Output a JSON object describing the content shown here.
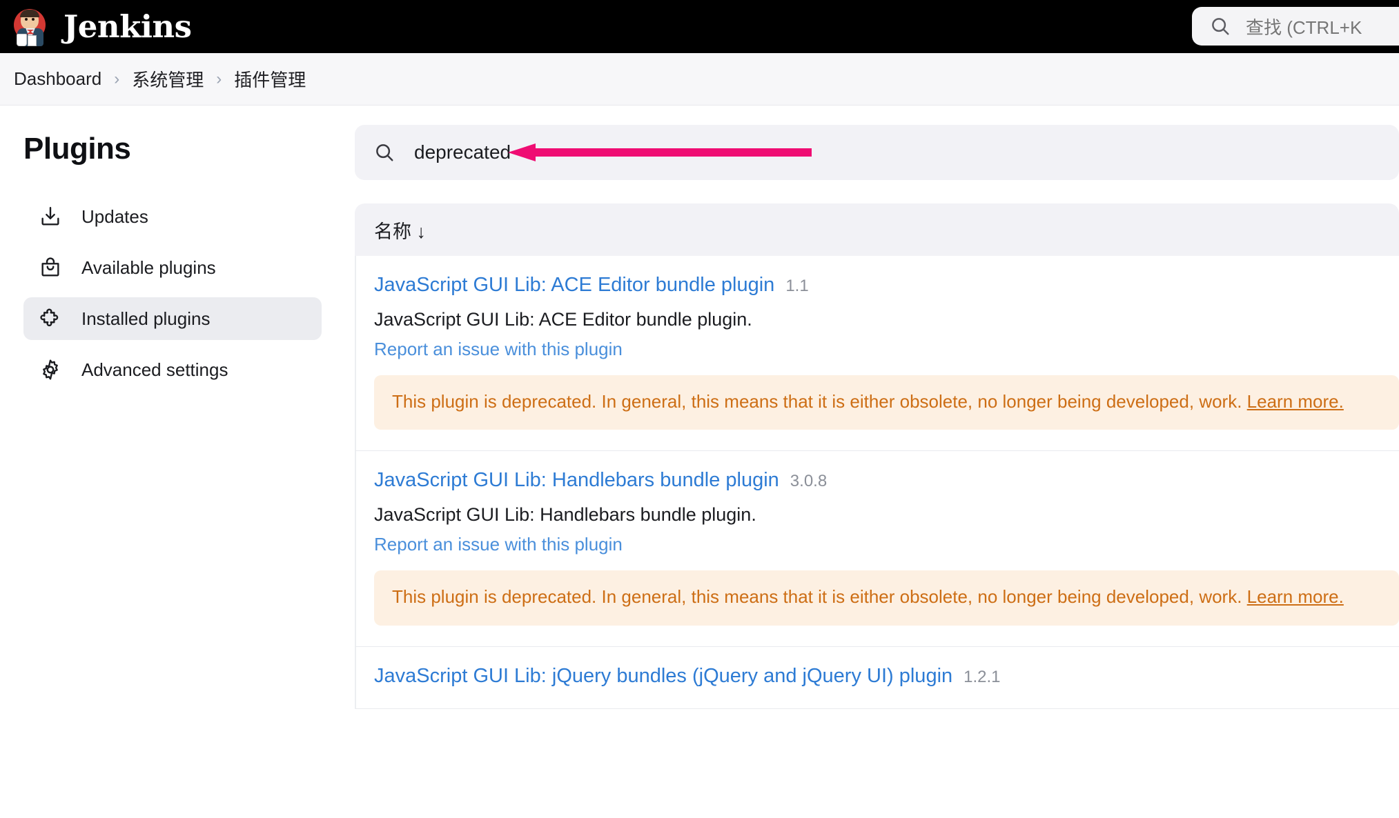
{
  "appbar": {
    "brand": "Jenkins",
    "search_placeholder": "查找 (CTRL+K"
  },
  "breadcrumb": {
    "items": [
      "Dashboard",
      "系统管理",
      "插件管理"
    ],
    "separator": "›"
  },
  "sidebar": {
    "title": "Plugins",
    "items": [
      {
        "label": "Updates",
        "icon": "download-icon",
        "active": false
      },
      {
        "label": "Available plugins",
        "icon": "shopping-bag-icon",
        "active": false
      },
      {
        "label": "Installed plugins",
        "icon": "puzzle-piece-icon",
        "active": true
      },
      {
        "label": "Advanced settings",
        "icon": "gear-icon",
        "active": false
      }
    ]
  },
  "plugin_search": {
    "value": "deprecated",
    "icon": "search-icon"
  },
  "annotation": {
    "type": "arrow",
    "direction": "left",
    "color": "#ef0d73"
  },
  "results": {
    "column_header": "名称 ↓",
    "sort_direction": "descending",
    "plugins": [
      {
        "name": "JavaScript GUI Lib: ACE Editor bundle plugin",
        "version": "1.1",
        "description": "JavaScript GUI Lib: ACE Editor bundle plugin.",
        "issue_link": "Report an issue with this plugin",
        "deprecation_text": "This plugin is deprecated. In general, this means that it is either obsolete, no longer being developed,",
        "deprecation_text_2": "work. ",
        "deprecation_link": "Learn more."
      },
      {
        "name": "JavaScript GUI Lib: Handlebars bundle plugin",
        "version": "3.0.8",
        "description": "JavaScript GUI Lib: Handlebars bundle plugin.",
        "issue_link": "Report an issue with this plugin",
        "deprecation_text": "This plugin is deprecated. In general, this means that it is either obsolete, no longer being developed,",
        "deprecation_text_2": "work. ",
        "deprecation_link": "Learn more."
      },
      {
        "name": "JavaScript GUI Lib: jQuery bundles (jQuery and jQuery UI) plugin",
        "version": "1.2.1",
        "description": "",
        "issue_link": "",
        "deprecation_text": "",
        "deprecation_text_2": "",
        "deprecation_link": ""
      }
    ]
  }
}
